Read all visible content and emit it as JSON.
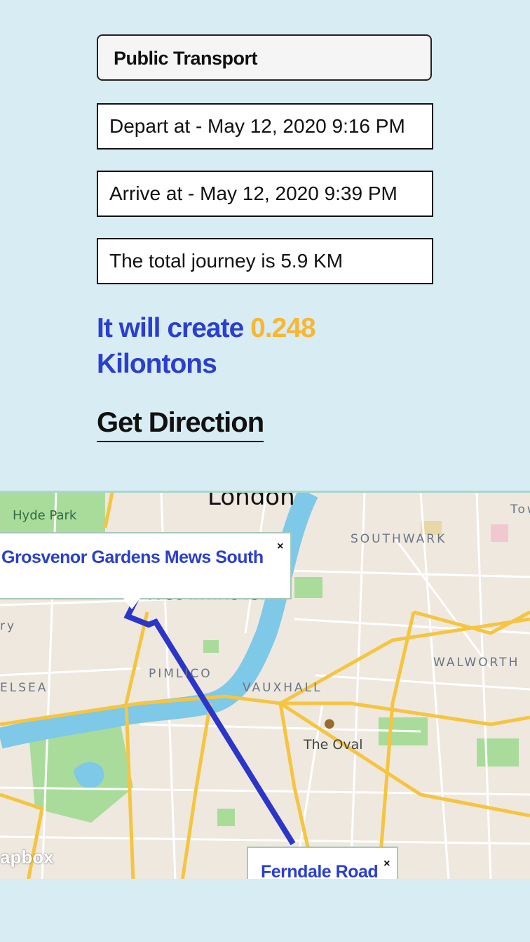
{
  "mode": "Public Transport",
  "depart": "Depart at - May 12, 2020 9:16 PM",
  "arrive": "Arrive at - May 12, 2020 9:39 PM",
  "distance": "The total journey is 5.9 KM",
  "emission": {
    "prefix": "It will create ",
    "amount": "0.248",
    "unit": "Kilontons"
  },
  "get_direction": "Get Direction",
  "map": {
    "labels": {
      "london": "London",
      "hyde_park": "Hyde Park",
      "southwark": "SOUTHWARK",
      "westminster": "Westminster",
      "pimlico": "PIMLICO",
      "vauxhall": "VAUXHALL",
      "walworth": "WALWORTH",
      "chelsea": "ELSEA",
      "the_oval": "The Oval",
      "tower": "Tow",
      "ry": "ry"
    },
    "start_popup": "Grosvenor Gardens Mews South",
    "end_popup": "Ferndale Road",
    "close_glyph": "×",
    "attribution": "apbox",
    "colors": {
      "route": "#2b36c9",
      "river": "#7ec8e8",
      "park": "#a9dc9a",
      "major_road": "#f5c542",
      "land": "#efe8df"
    }
  }
}
